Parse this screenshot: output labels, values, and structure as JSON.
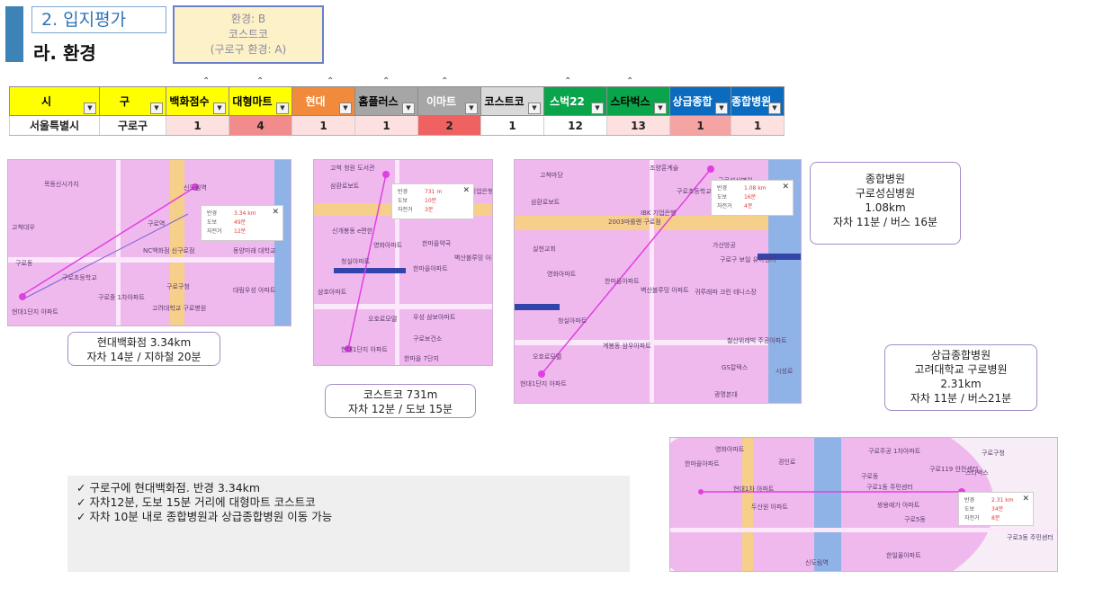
{
  "header": {
    "section_tag": "2. 입지평가",
    "title": "라. 환경"
  },
  "env_box": {
    "line1": "환경: B",
    "line2": "코스트코",
    "line3": "(구로구 환경: A)"
  },
  "table": {
    "headers": [
      {
        "label": "시",
        "bg": "#ffff00",
        "fg": "#000000"
      },
      {
        "label": "구",
        "bg": "#ffff00",
        "fg": "#000000"
      },
      {
        "label": "백화점수",
        "bg": "#ffff00",
        "fg": "#000000"
      },
      {
        "label": "대형마트",
        "bg": "#ffff00",
        "fg": "#000000"
      },
      {
        "label": "현대",
        "bg": "#f28a3c",
        "fg": "#ffffff"
      },
      {
        "label": "홈플러스",
        "bg": "#a6a6a6",
        "fg": "#000000"
      },
      {
        "label": "이마트",
        "bg": "#a6a6a6",
        "fg": "#ffffff"
      },
      {
        "label": "코스트코",
        "bg": "#d9d9d9",
        "fg": "#000000"
      },
      {
        "label": "스벅22",
        "bg": "#0aa54a",
        "fg": "#ffffff"
      },
      {
        "label": "스타벅스",
        "bg": "#0aa54a",
        "fg": "#000000"
      },
      {
        "label": "상급종합",
        "bg": "#0a6bbf",
        "fg": "#ffffff"
      },
      {
        "label": "종합병원",
        "bg": "#0a6bbf",
        "fg": "#ffffff"
      }
    ],
    "row": [
      {
        "value": "서울특별시",
        "bg": "#ffffff"
      },
      {
        "value": "구로구",
        "bg": "#ffffff"
      },
      {
        "value": "1",
        "bg": "#fde0e0"
      },
      {
        "value": "4",
        "bg": "#f28b8b"
      },
      {
        "value": "1",
        "bg": "#fde0e0"
      },
      {
        "value": "1",
        "bg": "#fde0e0"
      },
      {
        "value": "2",
        "bg": "#f06262"
      },
      {
        "value": "1",
        "bg": "#ffffff"
      },
      {
        "value": "12",
        "bg": "#ffffff"
      },
      {
        "value": "13",
        "bg": "#fde0e0"
      },
      {
        "value": "1",
        "bg": "#f5a3a3"
      },
      {
        "value": "1",
        "bg": "#fde0e0"
      }
    ]
  },
  "maps": {
    "hyundai": {
      "labels": [
        "신도림역",
        "구로역",
        "고척대우",
        "NC백화점 신구로점",
        "구로구청",
        "고려대학교 구로병원",
        "현대1단지 아파트",
        "목동신시가지",
        "대림우성 아파트",
        "구로동",
        "구로중 1차아파트",
        "구로초등학교",
        "동양미래 대학교"
      ],
      "popup": [
        {
          "k": "반경",
          "v": "3.34 km"
        },
        {
          "k": "도보",
          "v": "49분"
        },
        {
          "k": "자전거",
          "v": "12분"
        }
      ]
    },
    "costco": {
      "labels": [
        "고척 청원 도서관",
        "IBK 기업은행",
        "삼환로보트",
        "한마을약국",
        "영화아파트",
        "벽산블루밍 아파트",
        "신개봉동 e편한",
        "한마을아파트",
        "삼호아파트",
        "청실아파트",
        "우성 삼보아파트",
        "오호로모델",
        "구로보건소",
        "현대1단지 아파트",
        "한마을 7단지"
      ],
      "popup": [
        {
          "k": "반경",
          "v": "731 m"
        },
        {
          "k": "도보",
          "v": "10분"
        },
        {
          "k": "자전거",
          "v": "3분"
        }
      ]
    },
    "hospital": {
      "labels": [
        "고척마당",
        "IBK 기업은행",
        "조양훈계슬",
        "2003마를렌 구로점",
        "구로초등학교",
        "삼환로보트",
        "실현교회",
        "영화아파트",
        "한마을아파트",
        "벽산블루밍 아파트",
        "가산방공",
        "구로구 보일 유아센터",
        "귀루래파 크린 테니스장",
        "철산위레빅 주공아파트",
        "시성로",
        "청실아파트",
        "계봉동 삼우아파트",
        "오호로모델",
        "현대1단지 아파트",
        "GS칼텍스",
        "광명본대",
        "구로성심병원"
      ],
      "popup": [
        {
          "k": "반경",
          "v": "1.08 km"
        },
        {
          "k": "도보",
          "v": "16분"
        },
        {
          "k": "자전거",
          "v": "4분"
        }
      ]
    },
    "premium": {
      "labels": [
        "영화아파트",
        "구로주공 1차아파트",
        "구로119 안전센터",
        "한마을아파트",
        "구로구청",
        "스타벅스",
        "현대1차 아파트",
        "두산원 아파트",
        "구로동",
        "구로1동 주민센터",
        "신도림역",
        "쌍용예가 아파트",
        "구로3동 주민센터",
        "한일올아파트",
        "구로5동",
        "경인로"
      ],
      "popup": [
        {
          "k": "반경",
          "v": "2.31 km"
        },
        {
          "k": "도보",
          "v": "34분"
        },
        {
          "k": "자전거",
          "v": "8분"
        }
      ]
    }
  },
  "captions": {
    "hyundai": [
      "현대백화점 3.34km",
      "자차 14분 / 지하철 20분"
    ],
    "costco": [
      "코스트코 731m",
      "자차 12분 / 도보 15분"
    ],
    "hospital": [
      "종합병원",
      "구로성심병원",
      "1.08km",
      "자차 11분 / 버스 16분"
    ],
    "premium": [
      "상급종합병원",
      "고려대학교 구로병원",
      "2.31km",
      "자차 11분 / 버스21분"
    ]
  },
  "summary": [
    "✓ 구로구에 현대백화점. 반경 3.34km",
    "✓ 자차12분, 도보 15분 거리에 대형마트 코스트코",
    "✓ 자차 10분 내로 종합병원과 상급종합병원 이동 가능"
  ],
  "colors": {
    "accent": "#3d83b7",
    "map_pink": "#f0b9ee",
    "route": "#e040e0"
  }
}
